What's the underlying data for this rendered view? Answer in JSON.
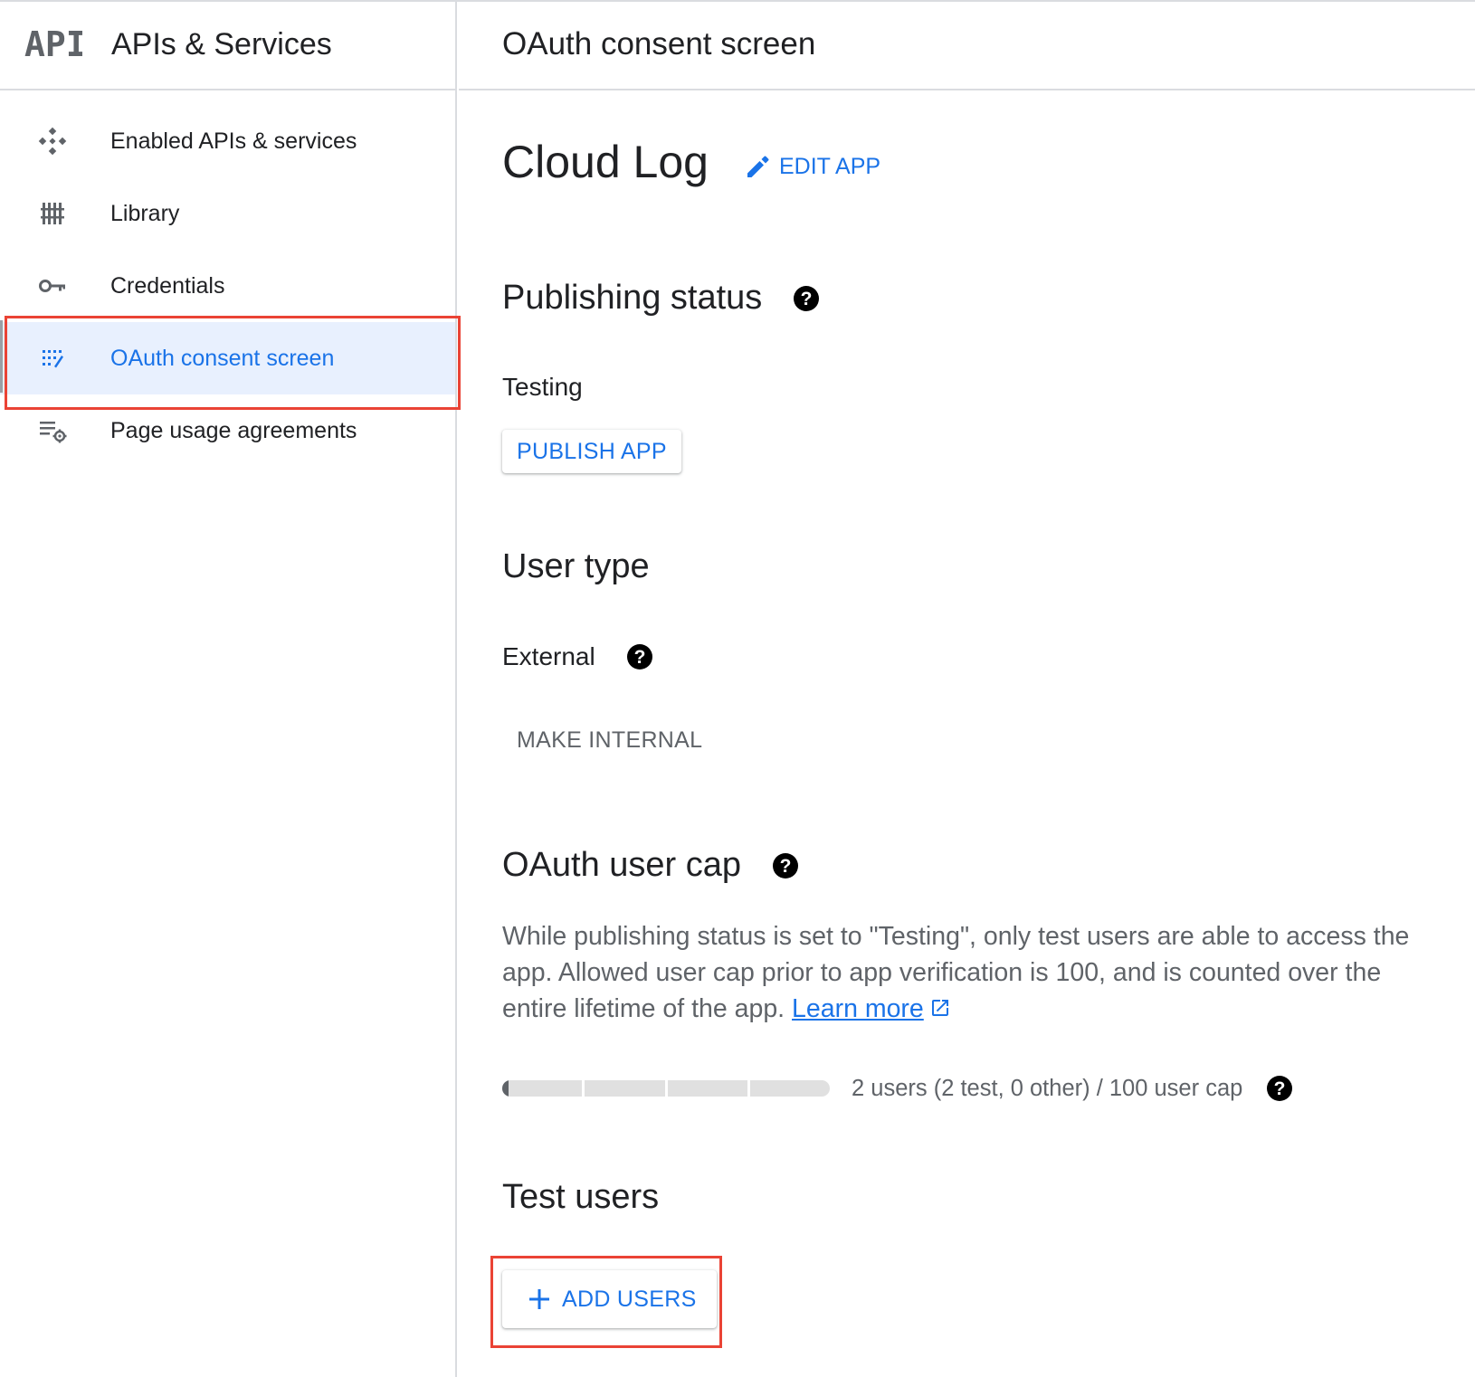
{
  "sidebar": {
    "logo": "API",
    "title": "APIs & Services",
    "items": [
      {
        "label": "Enabled APIs & services",
        "icon": "enabled-apis-icon",
        "active": false
      },
      {
        "label": "Library",
        "icon": "library-icon",
        "active": false
      },
      {
        "label": "Credentials",
        "icon": "key-icon",
        "active": false
      },
      {
        "label": "OAuth consent screen",
        "icon": "consent-screen-icon",
        "active": true
      },
      {
        "label": "Page usage agreements",
        "icon": "settings-list-icon",
        "active": false
      }
    ]
  },
  "header": {
    "title": "OAuth consent screen"
  },
  "app": {
    "name": "Cloud Log",
    "edit_label": "EDIT APP"
  },
  "publishing": {
    "title": "Publishing status",
    "status": "Testing",
    "publish_label": "PUBLISH APP"
  },
  "user_type": {
    "title": "User type",
    "value": "External",
    "make_internal_label": "MAKE INTERNAL"
  },
  "user_cap": {
    "title": "OAuth user cap",
    "description": "While publishing status is set to \"Testing\", only test users are able to access the app. Allowed user cap prior to app verification is 100, and is counted over the entire lifetime of the app.",
    "learn_more": "Learn more",
    "usage_text": "2 users (2 test, 0 other) / 100 user cap",
    "used": 2,
    "cap": 100
  },
  "test_users": {
    "title": "Test users",
    "add_label": "ADD USERS"
  },
  "colors": {
    "accent": "#1a73e8",
    "highlight_outline": "#ea4335",
    "active_bg": "#e8f0fe"
  }
}
